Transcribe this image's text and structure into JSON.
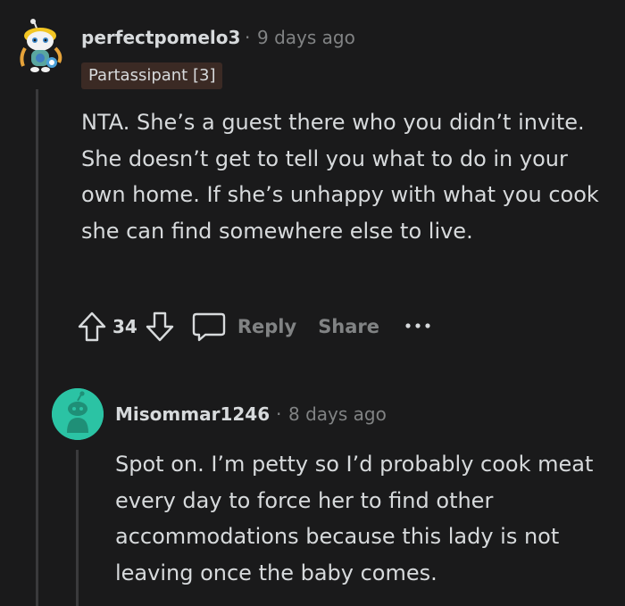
{
  "comments": [
    {
      "author": "perfectpomelo3",
      "separator": "·",
      "time": "9 days ago",
      "flair": "Partassipant [3]",
      "body": "NTA. She’s a guest there who you didn’t invite. She doesn’t get to tell you what to do in your own home. If she’s unhappy with what you cook she can find somewhere else to live.",
      "votes": "34",
      "actions": {
        "reply": "Reply",
        "share": "Share",
        "more": "•••"
      },
      "avatar_icon": "snoo-avatar-icon"
    },
    {
      "author": "Misommar1246",
      "separator": "·",
      "time": "8 days ago",
      "body": "Spot on. I’m petty so I’d probably cook meat every day to force her to find other accommodations because this lady is not leaving once the baby comes.",
      "avatar_icon": "default-snoo-avatar-icon"
    }
  ],
  "colors": {
    "background": "#1a1a1b",
    "text": "#d7dadc",
    "muted": "#818384",
    "flair_bg": "#3b2a24",
    "avatar_teal": "#2bc3a4",
    "thread_line": "#3a3a3c"
  }
}
